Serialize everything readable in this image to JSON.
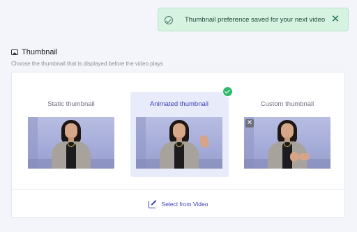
{
  "toast": {
    "message": "Thumbnail preference saved for your next video",
    "close_glyph": "✕",
    "check_icon": "check-circle-icon"
  },
  "section": {
    "title": "Thumbnail",
    "subtitle": "Choose the thumbnail that is displayed before the video plays",
    "icon": "image-icon"
  },
  "options": [
    {
      "label": "Static thumbnail",
      "selected": false
    },
    {
      "label": "Animated thumbnail",
      "selected": true
    },
    {
      "label": "Custom thumbnail",
      "selected": false,
      "remove_glyph": "✕"
    }
  ],
  "footer": {
    "select_label": "Select from Video",
    "icon": "edit-icon"
  },
  "colors": {
    "accent": "#3a3fb8",
    "success": "#2fb96c",
    "toast_bg": "#d6f2e1",
    "selected_bg": "#e8ebfa"
  }
}
